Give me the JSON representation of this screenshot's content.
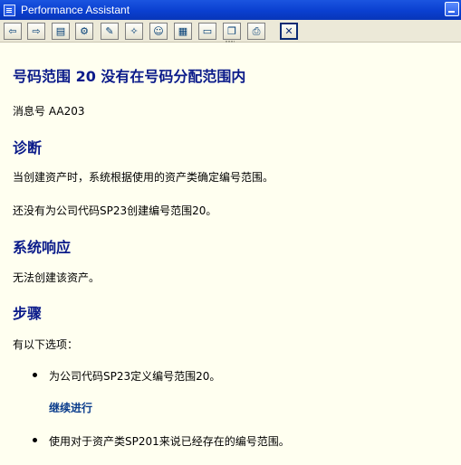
{
  "window": {
    "title": "Performance Assistant"
  },
  "toolbar": {
    "buttons": [
      {
        "name": "back-arrow-icon",
        "glyph": "⇦"
      },
      {
        "name": "forward-arrow-icon",
        "glyph": "⇨"
      },
      {
        "name": "book-icon",
        "glyph": "▤"
      },
      {
        "name": "technical-info-icon",
        "glyph": "⚙"
      },
      {
        "name": "edit-icon",
        "glyph": "✎"
      },
      {
        "name": "enhancement-icon",
        "glyph": "✧"
      },
      {
        "name": "help-people-icon",
        "glyph": "☺"
      },
      {
        "name": "document-icon",
        "glyph": "▦"
      },
      {
        "name": "bookmark-icon",
        "glyph": "▭"
      },
      {
        "name": "copy-icon",
        "glyph": "❐"
      },
      {
        "name": "print-icon",
        "glyph": "⎙"
      },
      {
        "name": "exit-icon",
        "glyph": "✕"
      }
    ]
  },
  "doc": {
    "title": "号码范围 20 没有在号码分配范围内",
    "message_no": "消息号 AA203",
    "diagnosis_heading": "诊断",
    "diagnosis_1": "当创建资产时，系统根据使用的资产类确定编号范围。",
    "diagnosis_2": "还没有为公司代码SP23创建编号范围20。",
    "response_heading": "系统响应",
    "response_text": "无法创建该资产。",
    "steps_heading": "步骤",
    "steps_intro": "有以下选项：",
    "option_1": "为公司代码SP23定义编号范围20。",
    "option_1_link": "继续进行",
    "option_2": "使用对于资产类SP201来说已经存在的编号范围。"
  }
}
